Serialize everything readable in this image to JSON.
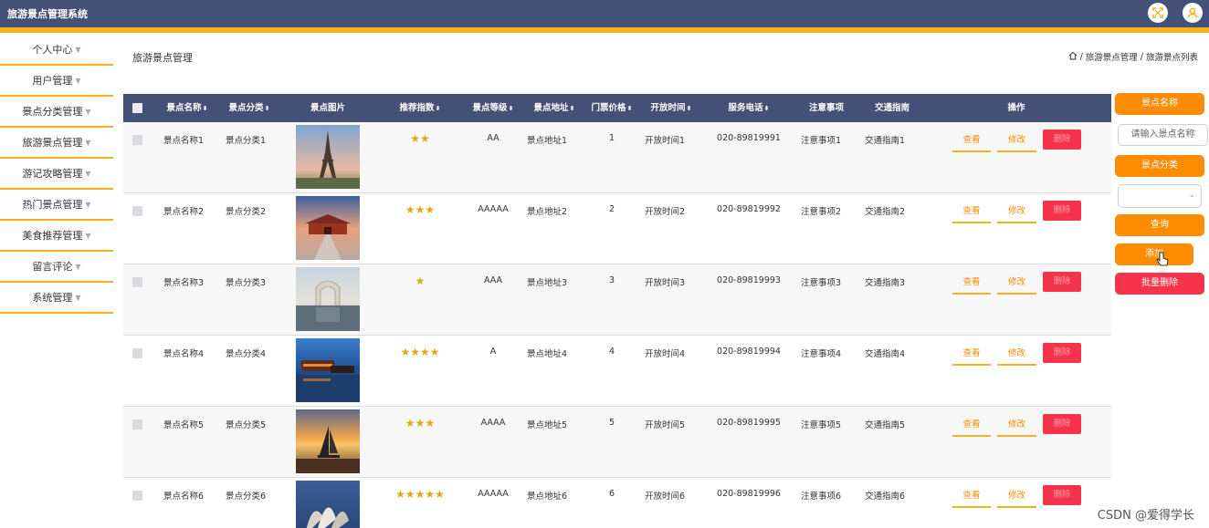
{
  "app": {
    "title": "旅游景点管理系统"
  },
  "topbar_icons": [
    "fullscreen-icon",
    "user-icon"
  ],
  "colors": {
    "header": "#445075",
    "accent": "#f6b01a",
    "orange": "#ff8c00",
    "danger": "#f5334b"
  },
  "sidebar": {
    "items": [
      {
        "label": "个人中心"
      },
      {
        "label": "用户管理"
      },
      {
        "label": "景点分类管理"
      },
      {
        "label": "旅游景点管理"
      },
      {
        "label": "游记攻略管理"
      },
      {
        "label": "热门景点管理"
      },
      {
        "label": "美食推荐管理"
      },
      {
        "label": "留言评论"
      },
      {
        "label": "系统管理"
      }
    ]
  },
  "page": {
    "title": "旅游景点管理",
    "breadcrumb": [
      "旅游景点管理",
      "旅游景点列表"
    ]
  },
  "table": {
    "headers": {
      "name": "景点名称",
      "category": "景点分类",
      "image": "景点图片",
      "rating": "推荐指数",
      "level": "景点等级",
      "address": "景点地址",
      "price": "门票价格",
      "hours": "开放时间",
      "phone": "服务电话",
      "notes": "注意事项",
      "guide": "交通指南",
      "actions": "操作"
    },
    "sort_glyph": "⬍",
    "actions": {
      "view": "查看",
      "edit": "修改",
      "delete": "删除"
    },
    "rows": [
      {
        "name": "景点名称1",
        "category": "景点分类1",
        "image": "eiffel-tower-photo",
        "stars": "★★",
        "level": "AA",
        "address": "景点地址1",
        "price": "1",
        "hours": "开放时间1",
        "phone": "020-89819991",
        "notes": "注意事项1",
        "guide": "交通指南1"
      },
      {
        "name": "景点名称2",
        "category": "景点分类2",
        "image": "palace-gate-photo",
        "stars": "★★★",
        "level": "AAAAA",
        "address": "景点地址2",
        "price": "2",
        "hours": "开放时间2",
        "phone": "020-89819992",
        "notes": "注意事项2",
        "guide": "交通指南2"
      },
      {
        "name": "景点名称3",
        "category": "景点分类3",
        "image": "arch-pavilion-photo",
        "stars": "★",
        "level": "AAA",
        "address": "景点地址3",
        "price": "3",
        "hours": "开放时间3",
        "phone": "020-89819993",
        "notes": "注意事项3",
        "guide": "交通指南3"
      },
      {
        "name": "景点名称4",
        "category": "景点分类4",
        "image": "water-town-night-photo",
        "stars": "★★★★",
        "level": "A",
        "address": "景点地址4",
        "price": "4",
        "hours": "开放时间4",
        "phone": "020-89819994",
        "notes": "注意事项4",
        "guide": "交通指南4"
      },
      {
        "name": "景点名称5",
        "category": "景点分类5",
        "image": "sailboat-sunset-photo",
        "stars": "★★★",
        "level": "AAAA",
        "address": "景点地址5",
        "price": "5",
        "hours": "开放时间5",
        "phone": "020-89819995",
        "notes": "注意事项5",
        "guide": "交通指南5"
      },
      {
        "name": "景点名称6",
        "category": "景点分类6",
        "image": "opera-house-photo",
        "stars": "★★★★★",
        "level": "AAAAA",
        "address": "景点地址6",
        "price": "6",
        "hours": "开放时间6",
        "phone": "020-89819996",
        "notes": "注意事项6",
        "guide": "交通指南6"
      }
    ]
  },
  "search_panel": {
    "name_label": "景点名称",
    "name_placeholder": "请输入景点名称",
    "category_label": "景点分类",
    "category_value": "",
    "query_button": "查询",
    "add_button": "添加",
    "batch_delete_button": "批量删除"
  },
  "watermark": "CSDN @爱得学长"
}
